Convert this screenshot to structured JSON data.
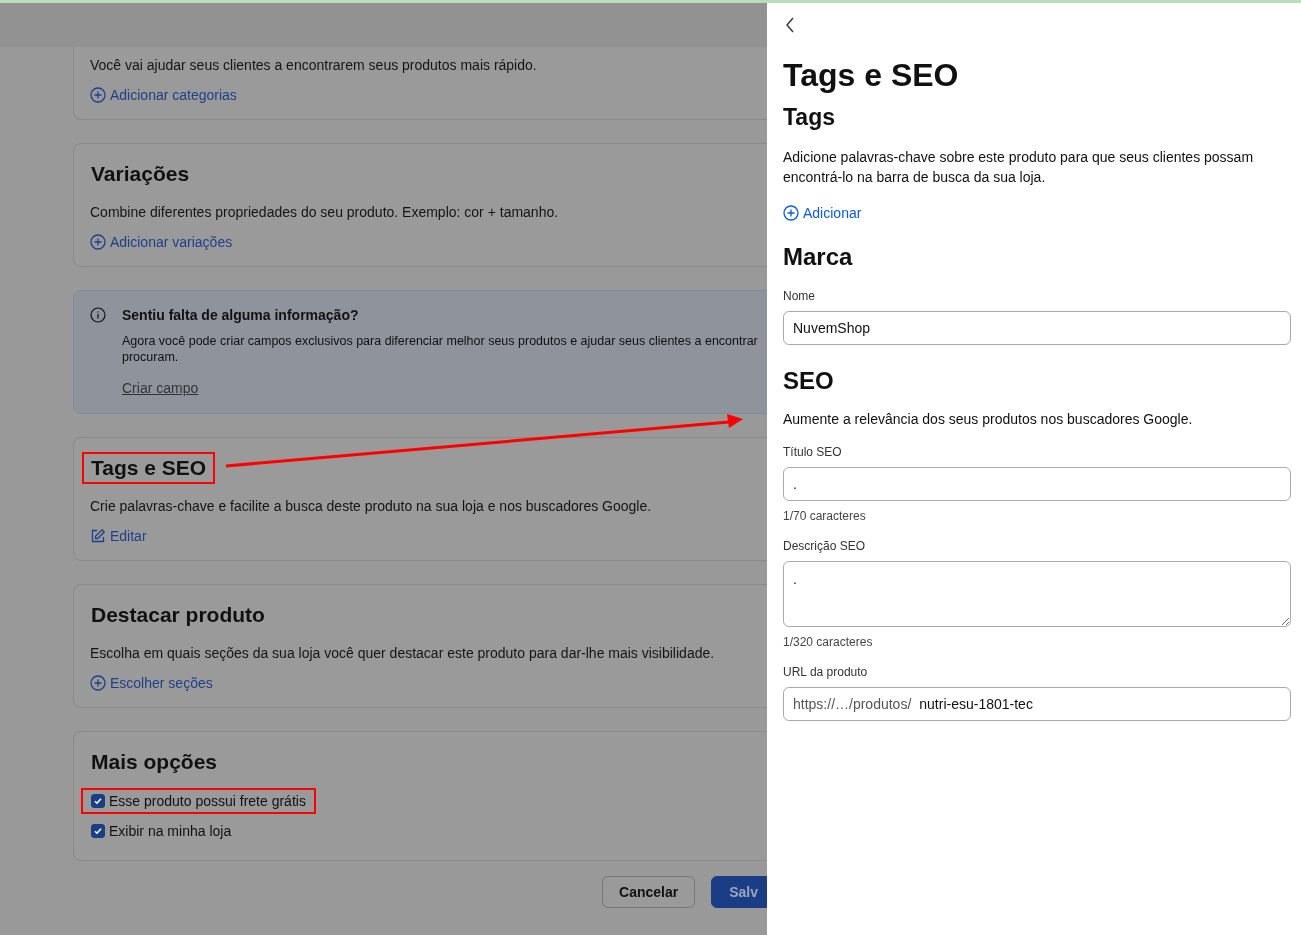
{
  "sections": [
    {
      "kind": "link_card",
      "description": "Você vai ajudar seus clientes a encontrarem seus produtos mais rápido.",
      "action": {
        "kind": "add",
        "label": "Adicionar categorias"
      }
    },
    {
      "kind": "link_card",
      "title": "Variações",
      "highlighted": false,
      "description": "Combine diferentes propriedades do seu produto. Exemplo: cor + tamanho.",
      "action": {
        "kind": "add",
        "label": "Adicionar variações"
      }
    },
    {
      "kind": "info",
      "title": "Sentiu falta de alguma informação?",
      "description": "Agora você pode criar campos exclusivos para diferenciar melhor seus produtos e ajudar seus clientes a encontrar\nprocuram.",
      "link": "Criar campo"
    },
    {
      "kind": "link_card",
      "title": "Tags e SEO",
      "highlighted": true,
      "description": "Crie palavras-chave e facilite a busca deste produto na sua loja e nos buscadores Google.",
      "action": {
        "kind": "edit",
        "label": "Editar"
      }
    },
    {
      "kind": "link_card",
      "title": "Destacar produto",
      "highlighted": false,
      "description": "Escolha em quais seções da sua loja você quer destacar este produto para dar-lhe mais visibilidade.",
      "action": {
        "kind": "add",
        "label": "Escolher seções"
      }
    },
    {
      "kind": "options",
      "title": "Mais opções",
      "options": [
        {
          "label": "Esse produto possui frete grátis",
          "checked": true,
          "highlighted": true
        },
        {
          "label": "Exibir na minha loja",
          "checked": true,
          "highlighted": false
        }
      ]
    }
  ],
  "footer_buttons": [
    {
      "label": "Cancelar",
      "kind": "secondary"
    },
    {
      "label": "Salv",
      "kind": "primary"
    }
  ],
  "panel": {
    "title": "Tags e SEO",
    "tags": {
      "title": "Tags",
      "description": "Adicione palavras-chave sobre este produto para que seus clientes possam encontrá-lo na barra de busca da sua loja.",
      "action": "Adicionar"
    },
    "brand": {
      "title": "Marca",
      "field": {
        "label": "Nome",
        "value": "NuvemShop"
      }
    },
    "seo": {
      "title": "SEO",
      "description": "Aumente a relevância dos seus produtos nos buscadores Google.",
      "fields": [
        {
          "kind": "input",
          "label": "Título SEO",
          "value": ".",
          "counter": "1/70 caracteres"
        },
        {
          "kind": "textarea",
          "label": "Descrição SEO",
          "value": ".",
          "counter": "1/320 caracteres"
        },
        {
          "kind": "url",
          "label": "URL da produto",
          "prefix": "https://…/produtos/",
          "value": "nutri-esu-1801-tec"
        }
      ]
    }
  }
}
